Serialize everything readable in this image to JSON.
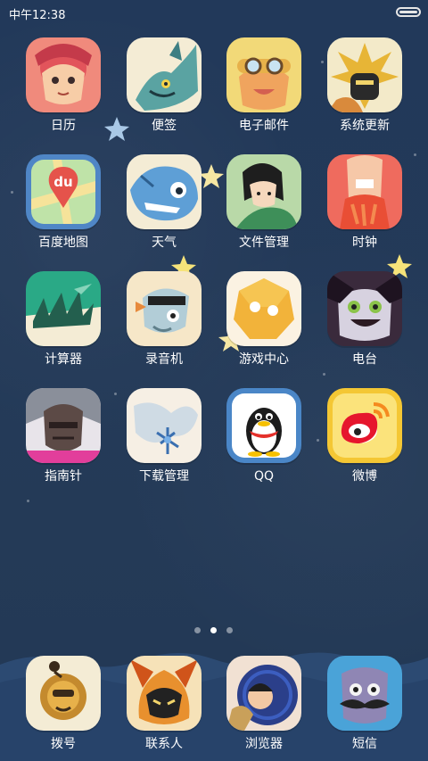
{
  "status_bar": {
    "time": "中午12:38",
    "battery_level_fraction": 1.0
  },
  "home_screen": {
    "apps": [
      {
        "label": "日历",
        "icon": "calendar-app-icon"
      },
      {
        "label": "便签",
        "icon": "notes-app-icon"
      },
      {
        "label": "电子邮件",
        "icon": "email-app-icon"
      },
      {
        "label": "系统更新",
        "icon": "system-update-app-icon"
      },
      {
        "label": "百度地图",
        "icon": "baidu-maps-app-icon"
      },
      {
        "label": "天气",
        "icon": "weather-app-icon"
      },
      {
        "label": "文件管理",
        "icon": "file-manager-app-icon"
      },
      {
        "label": "时钟",
        "icon": "clock-app-icon"
      },
      {
        "label": "计算器",
        "icon": "calculator-app-icon"
      },
      {
        "label": "录音机",
        "icon": "recorder-app-icon"
      },
      {
        "label": "游戏中心",
        "icon": "game-center-app-icon"
      },
      {
        "label": "电台",
        "icon": "radio-app-icon"
      },
      {
        "label": "指南针",
        "icon": "compass-app-icon"
      },
      {
        "label": "下载管理",
        "icon": "download-manager-app-icon"
      },
      {
        "label": "QQ",
        "icon": "qq-app-icon"
      },
      {
        "label": "微博",
        "icon": "weibo-app-icon"
      }
    ],
    "baidu_badge_text": "du"
  },
  "page_indicator": {
    "total_pages": 3,
    "current_page": 2
  },
  "dock": {
    "apps": [
      {
        "label": "拨号",
        "icon": "phone-dialer-app-icon"
      },
      {
        "label": "联系人",
        "icon": "contacts-app-icon"
      },
      {
        "label": "浏览器",
        "icon": "browser-app-icon"
      },
      {
        "label": "短信",
        "icon": "messages-app-icon"
      }
    ]
  },
  "colors": {
    "wallpaper": "#233a57",
    "label_text": "#ffffff",
    "star": "#f6e7a3"
  }
}
